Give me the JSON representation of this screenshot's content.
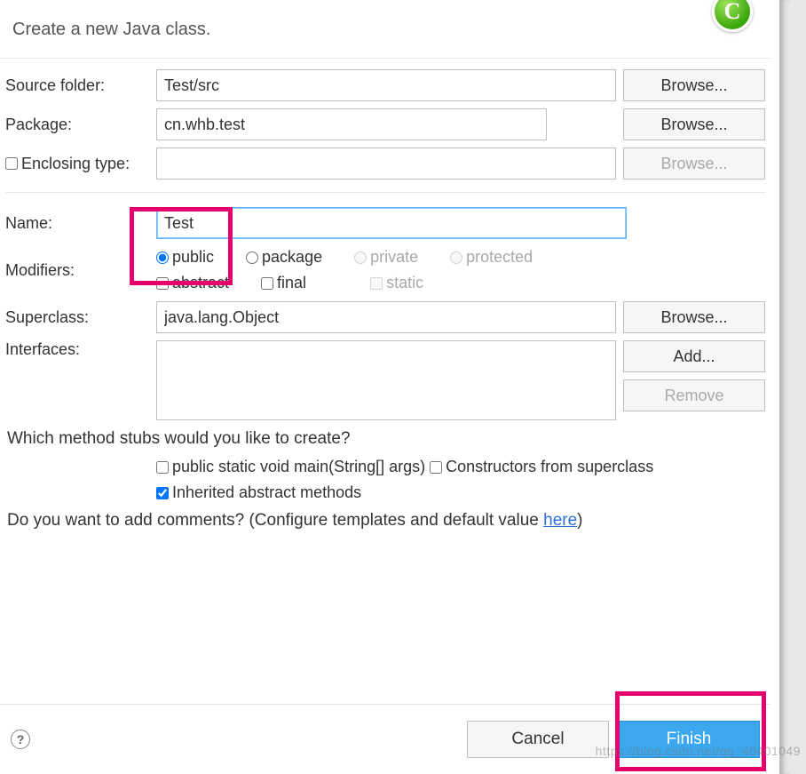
{
  "header": {
    "title": "Create a new Java class."
  },
  "labels": {
    "source_folder": "Source folder:",
    "package": "Package:",
    "enclosing_type": "Enclosing type:",
    "name": "Name:",
    "modifiers": "Modifiers:",
    "superclass": "Superclass:",
    "interfaces": "Interfaces:"
  },
  "fields": {
    "source_folder": "Test/src",
    "package": "cn.whb.test",
    "enclosing_type": "",
    "name": "Test",
    "superclass": "java.lang.Object"
  },
  "buttons": {
    "browse": "Browse...",
    "add": "Add...",
    "remove": "Remove",
    "cancel": "Cancel",
    "finish": "Finish"
  },
  "modifiers": {
    "radios": {
      "public": "public",
      "package": "package",
      "private": "private",
      "protected": "protected"
    },
    "checks": {
      "abstract": "abstract",
      "final": "final",
      "static": "static"
    },
    "selected_radio": "public"
  },
  "stubs": {
    "question": "Which method stubs would you like to create?",
    "main": "public static void main(String[] args)",
    "constructors": "Constructors from superclass",
    "inherited": "Inherited abstract methods"
  },
  "comments": {
    "question_prefix": "Do you want to add comments? (Configure templates and default value ",
    "link": "here",
    "question_suffix": ")"
  },
  "watermark": "https://blog.csdn.net/qq_46401049"
}
